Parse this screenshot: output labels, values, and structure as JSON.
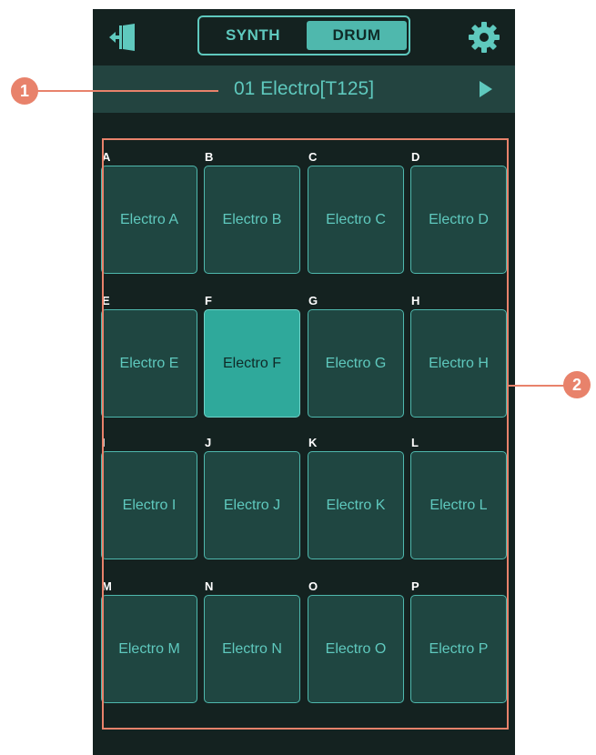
{
  "header": {
    "mode_tabs": [
      "SYNTH",
      "DRUM"
    ],
    "active_mode": "DRUM",
    "exit_icon": "exit-door-icon",
    "settings_icon": "gear-icon"
  },
  "preset": {
    "name": "01 Electro[T125]",
    "next_icon": "play-triangle-icon"
  },
  "pads": [
    {
      "letter": "A",
      "label": "Electro A"
    },
    {
      "letter": "B",
      "label": "Electro B"
    },
    {
      "letter": "C",
      "label": "Electro C"
    },
    {
      "letter": "D",
      "label": "Electro D"
    },
    {
      "letter": "E",
      "label": "Electro E"
    },
    {
      "letter": "F",
      "label": "Electro F"
    },
    {
      "letter": "G",
      "label": "Electro G"
    },
    {
      "letter": "H",
      "label": "Electro H"
    },
    {
      "letter": "I",
      "label": "Electro I"
    },
    {
      "letter": "J",
      "label": "Electro J"
    },
    {
      "letter": "K",
      "label": "Electro K"
    },
    {
      "letter": "L",
      "label": "Electro L"
    },
    {
      "letter": "M",
      "label": "Electro M"
    },
    {
      "letter": "N",
      "label": "Electro N"
    },
    {
      "letter": "O",
      "label": "Electro O"
    },
    {
      "letter": "P",
      "label": "Electro P"
    }
  ],
  "active_pad": "F",
  "callouts": {
    "preset": "1",
    "pads": "2"
  },
  "colors": {
    "accent": "#5fc9be",
    "active_pad": "#2fa99b",
    "background": "#142220",
    "callout": "#e8826b"
  }
}
